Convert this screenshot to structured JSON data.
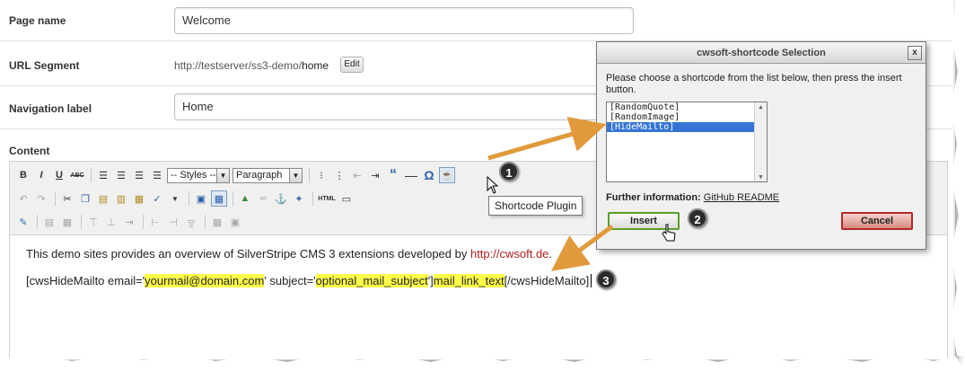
{
  "form": {
    "page_name": {
      "label": "Page name",
      "value": "Welcome"
    },
    "url_segment": {
      "label": "URL Segment",
      "prefix": "http://testserver/ss3-demo/",
      "segment": "home",
      "edit_label": "Edit"
    },
    "navigation_label": {
      "label": "Navigation label",
      "value": "Home"
    },
    "content_label": "Content"
  },
  "toolbar": {
    "styles_select": "-- Styles --",
    "paragraph_select": "Paragraph",
    "html_label": "HTML",
    "bold": "B",
    "italic": "I",
    "underline": "U",
    "strike": "ABC",
    "tooltip": "Shortcode Plugin"
  },
  "editor_content": {
    "line1_text": "This demo sites provides an overview of SilverStripe CMS 3 extensions developed by ",
    "line1_link": "http://cwsoft.de",
    "line1_end": ".",
    "line2_part1": "[cwsHideMailto email='",
    "line2_email": "yourmail@domain.com",
    "line2_part2": "' subject='",
    "line2_subject": "optional_mail_subject",
    "line2_part3": "']",
    "line2_linktext": "mail_link_text",
    "line2_part4": "[/cwsHideMailto]"
  },
  "dialog": {
    "title": "cwsoft-shortcode Selection",
    "close": "x",
    "instructions": "Please choose a shortcode from the list below, then press the insert button.",
    "options": [
      "[RandomQuote]",
      "[RandomImage]",
      "[HideMailto]"
    ],
    "selected_option": "[HideMailto]",
    "further_label": "Further information:",
    "further_link": "GitHub README",
    "insert_label": "Insert",
    "cancel_label": "Cancel"
  },
  "callouts": [
    "1",
    "2",
    "3"
  ],
  "colors": {
    "arrow": "#e09a3c",
    "insert_border": "#5a9e2a",
    "cancel_border": "#b02a2a",
    "highlight": "#ffff4a",
    "link": "#b01e1e",
    "selection": "#3574d4"
  }
}
